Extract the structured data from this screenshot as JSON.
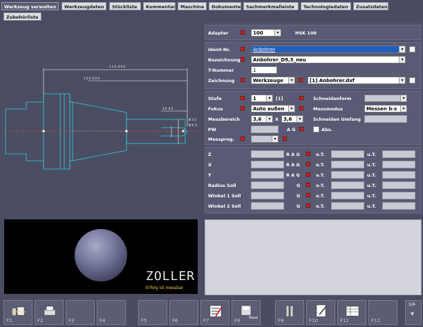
{
  "tabs": [
    "Werkzeug verwalten",
    "Werkzeugdaten",
    "Stückliste",
    "Kommentar",
    "Maschine",
    "Dokumente",
    "Sachmerkmalleiste",
    "Technologiedaten",
    "Zusatzdaten",
    "Zubehörliste"
  ],
  "drawing": {
    "dim_total": "1 2 0 .0 0 0",
    "dim_1": "1 0 0 .0 0 0",
    "dim_2": "3 0 .0 0",
    "dim_d1": "Ø 3 0",
    "dim_d2": "Ø 9 .5"
  },
  "form": {
    "adapter_label": "Adapter",
    "adapter_value": "100",
    "adapter_code": "HSK 100",
    "ident_label": "Ident-Nr.",
    "ident_value": "Anbohrer",
    "bezeichnung_label": "Bezeichnung",
    "bezeichnung_value": "Anbohrer_D9,5_neu",
    "tnummer_label": "T-Nummer",
    "tnummer_value": "1",
    "zeichnung_label": "Zeichnung",
    "zeichnung_value": "Werkzeuge",
    "zeichnung_file": "[1] Anbohrer.dxf",
    "stufe_label": "Stufe",
    "stufe_value": "1",
    "stufe_count": "[1]",
    "fokus_label": "Fokus",
    "fokus_value": "Auto außen",
    "messbereich_label": "Messbereich",
    "messbereich_x1": "3,6",
    "messbereich_x": "X",
    "messbereich_x2": "3,6",
    "pw_label": "PW",
    "ag_label": "A G",
    "abs_label": "Abs.",
    "messprog_label": "Messprog.",
    "schneidenform_label": "Schneidenform",
    "messmodus_label": "Messmodus",
    "messmodus_value": "Messen b-z",
    "schneidenumfang_label": "Schneiden Umfang",
    "axes": [
      {
        "label": "Z",
        "flags": "R A G",
        "ot": "o.T.",
        "ut": "u.T."
      },
      {
        "label": "X",
        "flags": "R A G",
        "ot": "o.T.",
        "ut": "u.T."
      },
      {
        "label": "Y",
        "flags": "R A G",
        "ot": "o.T.",
        "ut": "u.T."
      },
      {
        "label": "Radius Soll",
        "flags": "G",
        "ot": "o.T.",
        "ut": "u.T."
      },
      {
        "label": "Winkel 1 Soll",
        "flags": "G",
        "ot": "o.T.",
        "ut": "u.T."
      },
      {
        "label": "Winkel 2 Soll",
        "flags": "G",
        "ot": "o.T.",
        "ut": "u.T."
      }
    ]
  },
  "brand": {
    "logo": "ZOLLER",
    "slogan": "Erfolg ist messbar"
  },
  "fkeys": [
    "F1",
    "F2",
    "F3",
    "F4",
    "F5",
    "F6",
    "F7",
    "F8",
    "F9",
    "F10",
    "F11",
    "F12"
  ],
  "f8_sub": "Save",
  "page_indicator": "1/4"
}
